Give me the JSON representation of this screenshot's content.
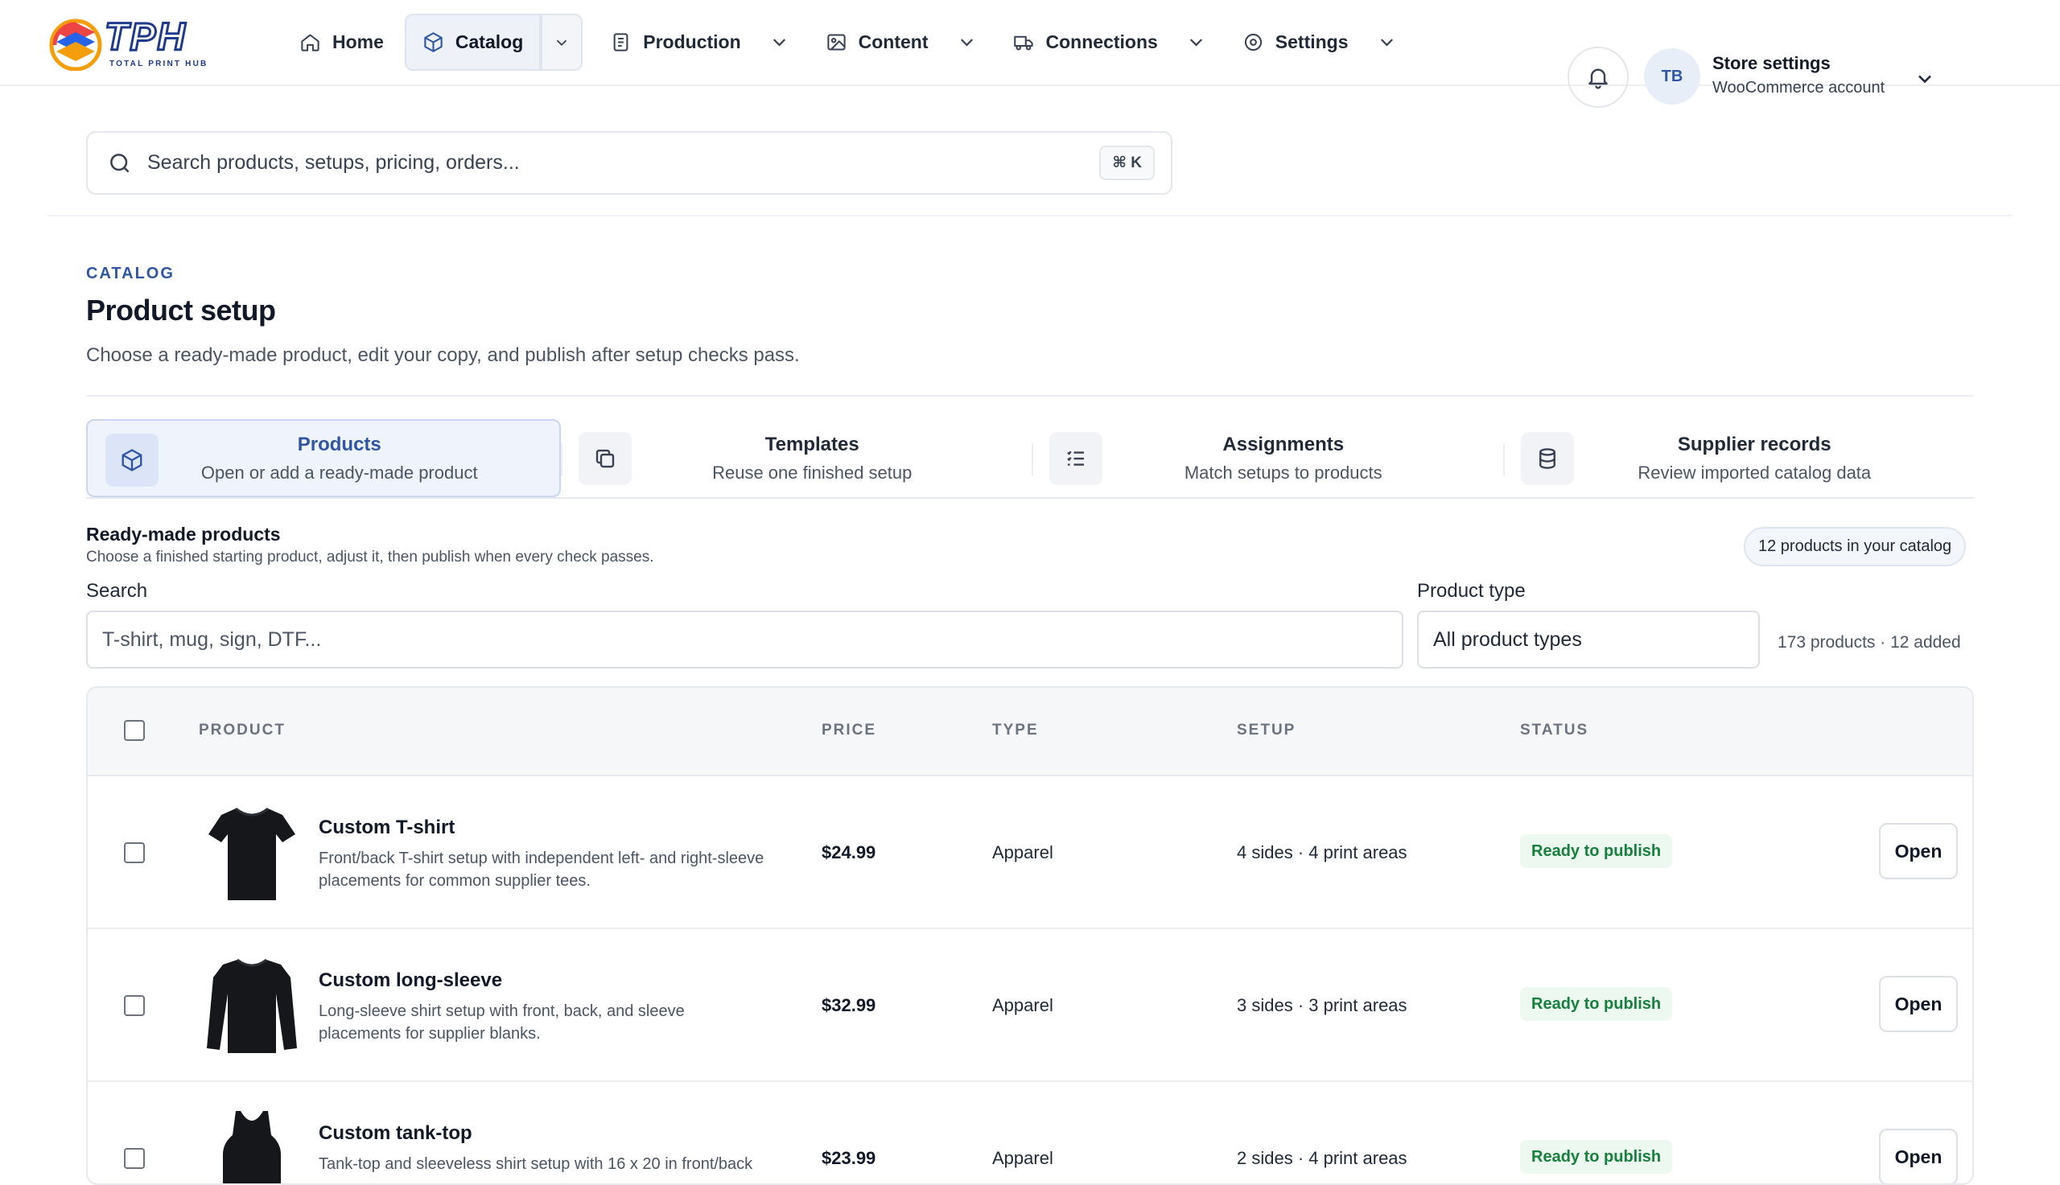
{
  "brand": {
    "logo_text": "TPH",
    "logo_tagline": "TOTAL PRINT HUB"
  },
  "nav": {
    "home": "Home",
    "catalog": "Catalog",
    "production": "Production",
    "content": "Content",
    "connections": "Connections",
    "settings": "Settings"
  },
  "search": {
    "placeholder": "Search products, setups, pricing, orders...",
    "shortcut": "⌘ K"
  },
  "account": {
    "initials": "TB",
    "title": "Store settings",
    "subtitle": "WooCommerce account"
  },
  "page": {
    "eyebrow": "CATALOG",
    "title": "Product setup",
    "subtitle": "Choose a ready-made product, edit your copy, and publish after setup checks pass."
  },
  "tabs": [
    {
      "title": "Products",
      "desc": "Open or add a ready-made product",
      "icon": "cube-icon"
    },
    {
      "title": "Templates",
      "desc": "Reuse one finished setup",
      "icon": "copy-icon"
    },
    {
      "title": "Assignments",
      "desc": "Match setups to products",
      "icon": "list-check-icon"
    },
    {
      "title": "Supplier records",
      "desc": "Review imported catalog data",
      "icon": "database-icon"
    }
  ],
  "section": {
    "title": "Ready-made products",
    "subtitle": "Choose a finished starting product, adjust it, then publish when every check passes.",
    "badge": "12 products in your catalog"
  },
  "filters": {
    "search_label": "Search",
    "search_placeholder": "T-shirt, mug, sign, DTF...",
    "type_label": "Product type",
    "type_value": "All product types",
    "count": "173 products · 12 added"
  },
  "table": {
    "headers": {
      "product": "PRODUCT",
      "price": "PRICE",
      "type": "TYPE",
      "setup": "SETUP",
      "status": "STATUS"
    },
    "open_label": "Open",
    "rows": [
      {
        "name": "Custom T-shirt",
        "desc": "Front/back T-shirt setup with independent left- and right-sleeve placements for common supplier tees.",
        "price": "$24.99",
        "type": "Apparel",
        "setup": "4 sides · 4 print areas",
        "status": "Ready to publish"
      },
      {
        "name": "Custom long-sleeve",
        "desc": "Long-sleeve shirt setup with front, back, and sleeve placements for supplier blanks.",
        "price": "$32.99",
        "type": "Apparel",
        "setup": "3 sides · 3 print areas",
        "status": "Ready to publish"
      },
      {
        "name": "Custom tank-top",
        "desc": "Tank-top and sleeveless shirt setup with 16 x 20 in front/back",
        "price": "$23.99",
        "type": "Apparel",
        "setup": "2 sides · 4 print areas",
        "status": "Ready to publish"
      }
    ]
  },
  "colors": {
    "accent": "#2f55a4",
    "ready": "#17803d",
    "ready_bg": "#edf8f1"
  }
}
